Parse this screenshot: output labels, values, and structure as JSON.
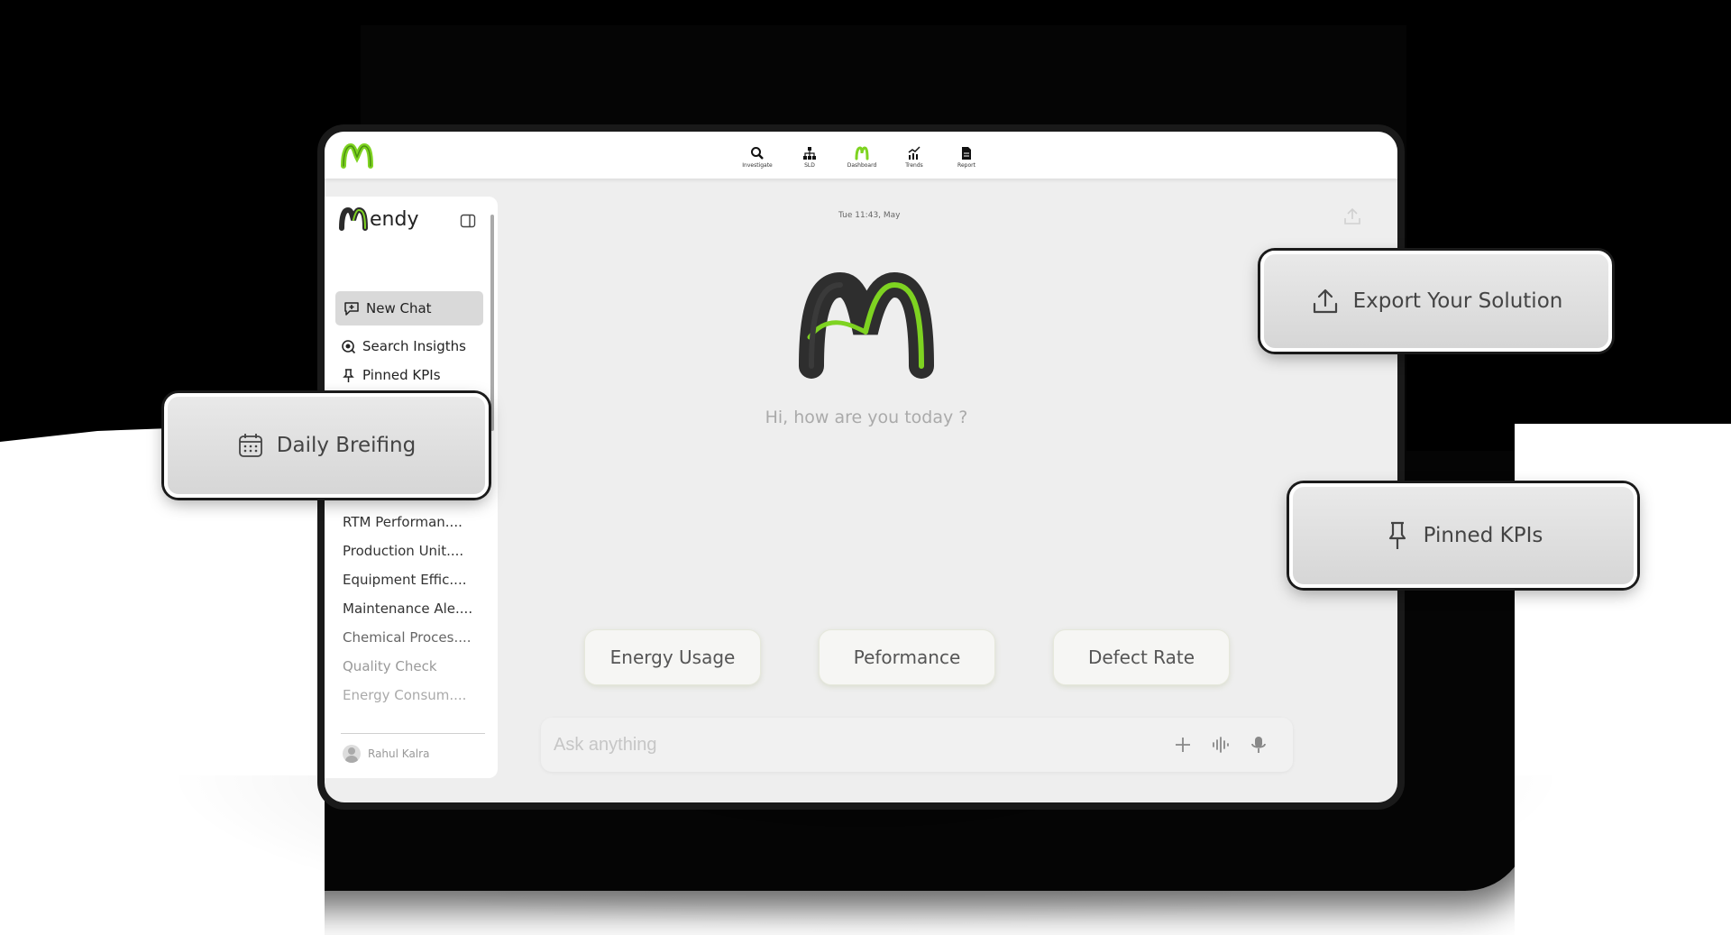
{
  "colors": {
    "accent": "#7ed321",
    "dark": "#2b2b2b"
  },
  "topbar": {
    "logo_icon": "mendy-logo-icon",
    "nav": [
      {
        "label": "Investigate",
        "icon": "search-icon"
      },
      {
        "label": "SLD",
        "icon": "hierarchy-icon"
      },
      {
        "label": "Dashboard",
        "icon": "mendy-logo-icon"
      },
      {
        "label": "Trends",
        "icon": "trend-chart-icon"
      },
      {
        "label": "Report",
        "icon": "document-icon"
      }
    ]
  },
  "sidebar": {
    "brand": "endy",
    "new_chat": "New Chat",
    "search": "Search Insigths",
    "pinned": "Pinned KPIs",
    "history": [
      "RTM Performan....",
      "Production Unit....",
      "Equipment Effic....",
      "Maintenance Ale....",
      "Chemical Proces....",
      "Quality Check",
      "Energy Consum...."
    ],
    "user": "Rahul Kalra"
  },
  "main": {
    "date": "Tue 11:43, May",
    "greeting": "Hi, how are you today ?",
    "chips": [
      "Energy Usage",
      "Peformance",
      "Defect Rate"
    ],
    "ask_placeholder": "Ask anything"
  },
  "floating": {
    "daily": "Daily Breifing",
    "export": "Export Your Solution",
    "pinned": "Pinned KPIs"
  }
}
